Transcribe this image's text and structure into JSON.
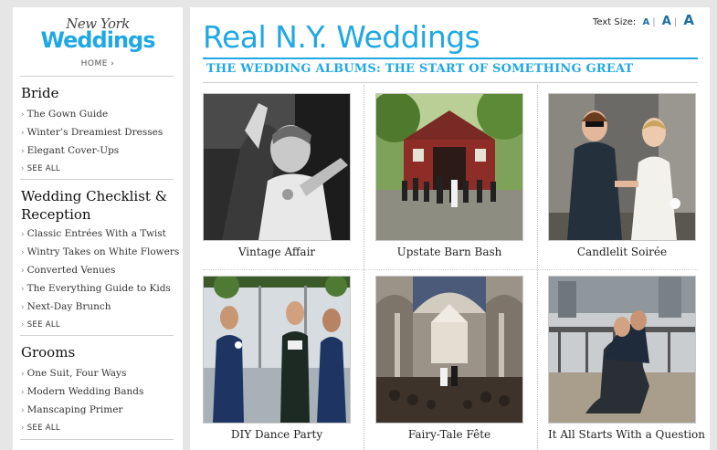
{
  "logo": {
    "line1": "New York",
    "line2": "Weddings"
  },
  "sidebar": {
    "home_label": "HOME ›",
    "sections": [
      {
        "title": "Bride",
        "links": [
          "The Gown Guide",
          "Winter’s Dreamiest Dresses",
          "Elegant Cover-Ups"
        ],
        "see_all": "SEE ALL"
      },
      {
        "title": "Wedding Checklist & Reception",
        "links": [
          "Classic Entrées With a Twist",
          "Wintry Takes on White Flowers",
          "Converted Venues",
          "The Everything Guide to Kids",
          "Next-Day Brunch"
        ],
        "see_all": "SEE ALL"
      },
      {
        "title": "Grooms",
        "links": [
          "One Suit, Four Ways",
          "Modern Wedding Bands",
          "Manscaping Primer"
        ],
        "see_all": "SEE ALL"
      }
    ],
    "link_arrow": "›"
  },
  "main": {
    "title": "Real N.Y. Weddings",
    "text_size": {
      "label": "Text Size:",
      "options": [
        "A",
        "A",
        "A"
      ],
      "separator": "|"
    },
    "album_heading": "THE WEDDING ALBUMS: THE START OF SOMETHING GREAT",
    "albums": [
      {
        "caption": "Vintage Affair",
        "photo": "black-and-white bride portrait"
      },
      {
        "caption": "Upstate Barn Bash",
        "photo": "red barn with guests"
      },
      {
        "caption": "Candlelit Soirée",
        "photo": "couple holding hands on street"
      },
      {
        "caption": "DIY Dance Party",
        "photo": "grooms at window ceremony"
      },
      {
        "caption": "Fairy-Tale Fête",
        "photo": "cathedral ceremony"
      },
      {
        "caption": "It All Starts With a Question",
        "photo": "proposal on rooftop"
      }
    ]
  },
  "colors": {
    "brand_blue": "#1fa8e3",
    "page_bg": "#e6e6e6"
  }
}
